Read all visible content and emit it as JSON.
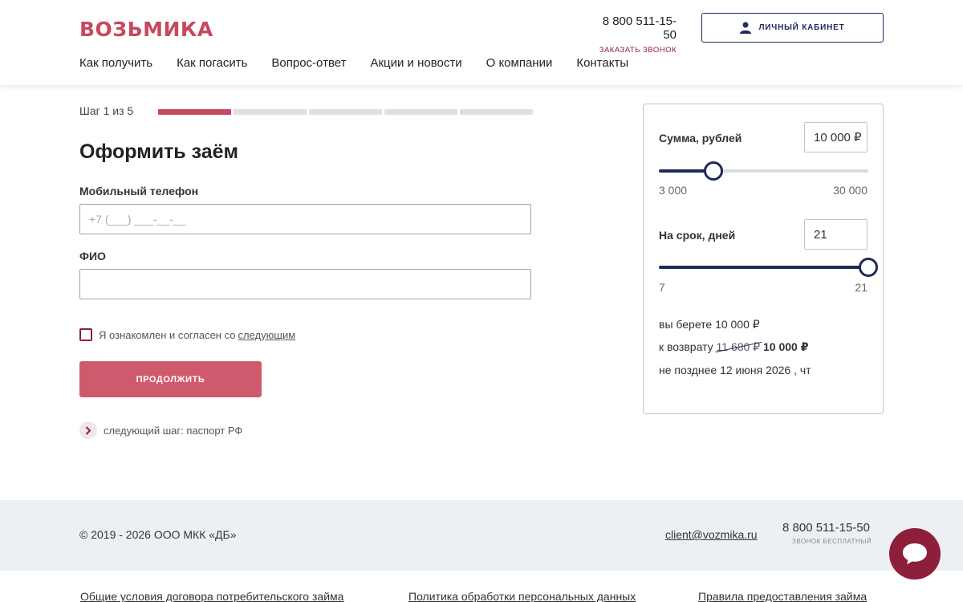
{
  "header": {
    "logo": "ВОЗЬМИКА",
    "phone": "8 800 511-15-50",
    "callback": "заказать звонок",
    "cabinet_label": "ЛИЧНЫЙ КАБИНЕТ",
    "nav": [
      "Как получить",
      "Как погасить",
      "Вопрос-ответ",
      "Акции и новости",
      "О компании",
      "Контакты"
    ]
  },
  "form": {
    "step_label": "Шаг 1 из 5",
    "step_current": 1,
    "step_total": 5,
    "title": "Оформить заём",
    "phone_label": "Мобильный телефон",
    "phone_placeholder": "+7 (___) ___-__-__",
    "phone_value": "",
    "fio_label": "ФИО",
    "fio_value": "",
    "agree_text": "Я ознакомлен и согласен со",
    "agree_link": "следующим",
    "agree_checked": false,
    "continue_label": "продолжить",
    "next_step": "следующий шаг: паспорт РФ"
  },
  "calculator": {
    "amount_label": "Сумма, рублей",
    "amount_value": "10 000 ₽",
    "amount_min": "3 000",
    "amount_max": "30 000",
    "amount_fraction": 0.26,
    "term_label": "На срок, дней",
    "term_value": "21",
    "term_min": "7",
    "term_max": "21",
    "term_fraction": 1.0,
    "take_text": "вы берете 10 000 ₽",
    "return_prefix": "к возврату",
    "return_old": "11 680 ₽",
    "return_new": "10 000 ₽",
    "deadline": "не позднее 12 июня 2026 , чт"
  },
  "footer": {
    "copyright": "© 2019 - 2026 ООО МКК «ДБ»",
    "email": "client@vozmika.ru",
    "phone": "8 800 511-15-50",
    "free_call": "звонок бесплатный",
    "links": [
      "Общие условия договора потребительского займа",
      "Политика обработки персональных данных",
      "Правила предоставления займа"
    ]
  },
  "colors": {
    "brand": "#c8485f",
    "navy": "#1f2a5a",
    "button": "#d05a6d",
    "chat": "#8d1f3a"
  },
  "icons": {
    "cabinet": "user-icon",
    "next_step": "chevron-right-icon",
    "chat": "chat-bubble-icon"
  }
}
